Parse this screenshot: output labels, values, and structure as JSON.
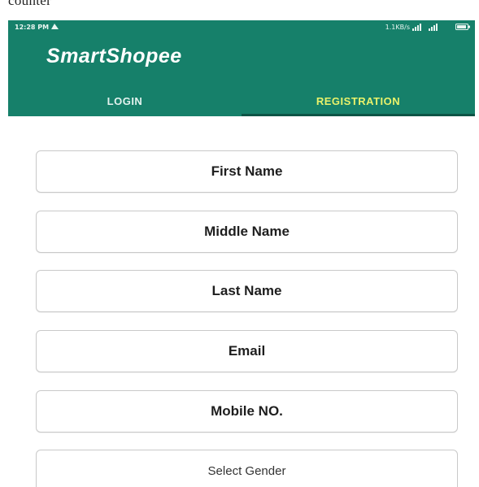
{
  "caption": {
    "text": "counter"
  },
  "status_bar": {
    "time": "12:28 PM",
    "network": "1.1KB/s",
    "icons": [
      "notification-icon",
      "signal-icon",
      "signal-4g-icon",
      "battery-icon"
    ]
  },
  "app": {
    "title": "SmartShopee",
    "header_color": "#16806a",
    "accent_color": "#e9f26a"
  },
  "tabs": [
    {
      "label": "LOGIN",
      "selected": false
    },
    {
      "label": "REGISTRATION",
      "selected": true
    }
  ],
  "form": {
    "first_name_placeholder": "First Name",
    "middle_name_placeholder": "Middle Name",
    "last_name_placeholder": "Last Name",
    "email_placeholder": "Email",
    "mobile_placeholder": "Mobile NO.",
    "gender_select_label": "Select Gender"
  }
}
